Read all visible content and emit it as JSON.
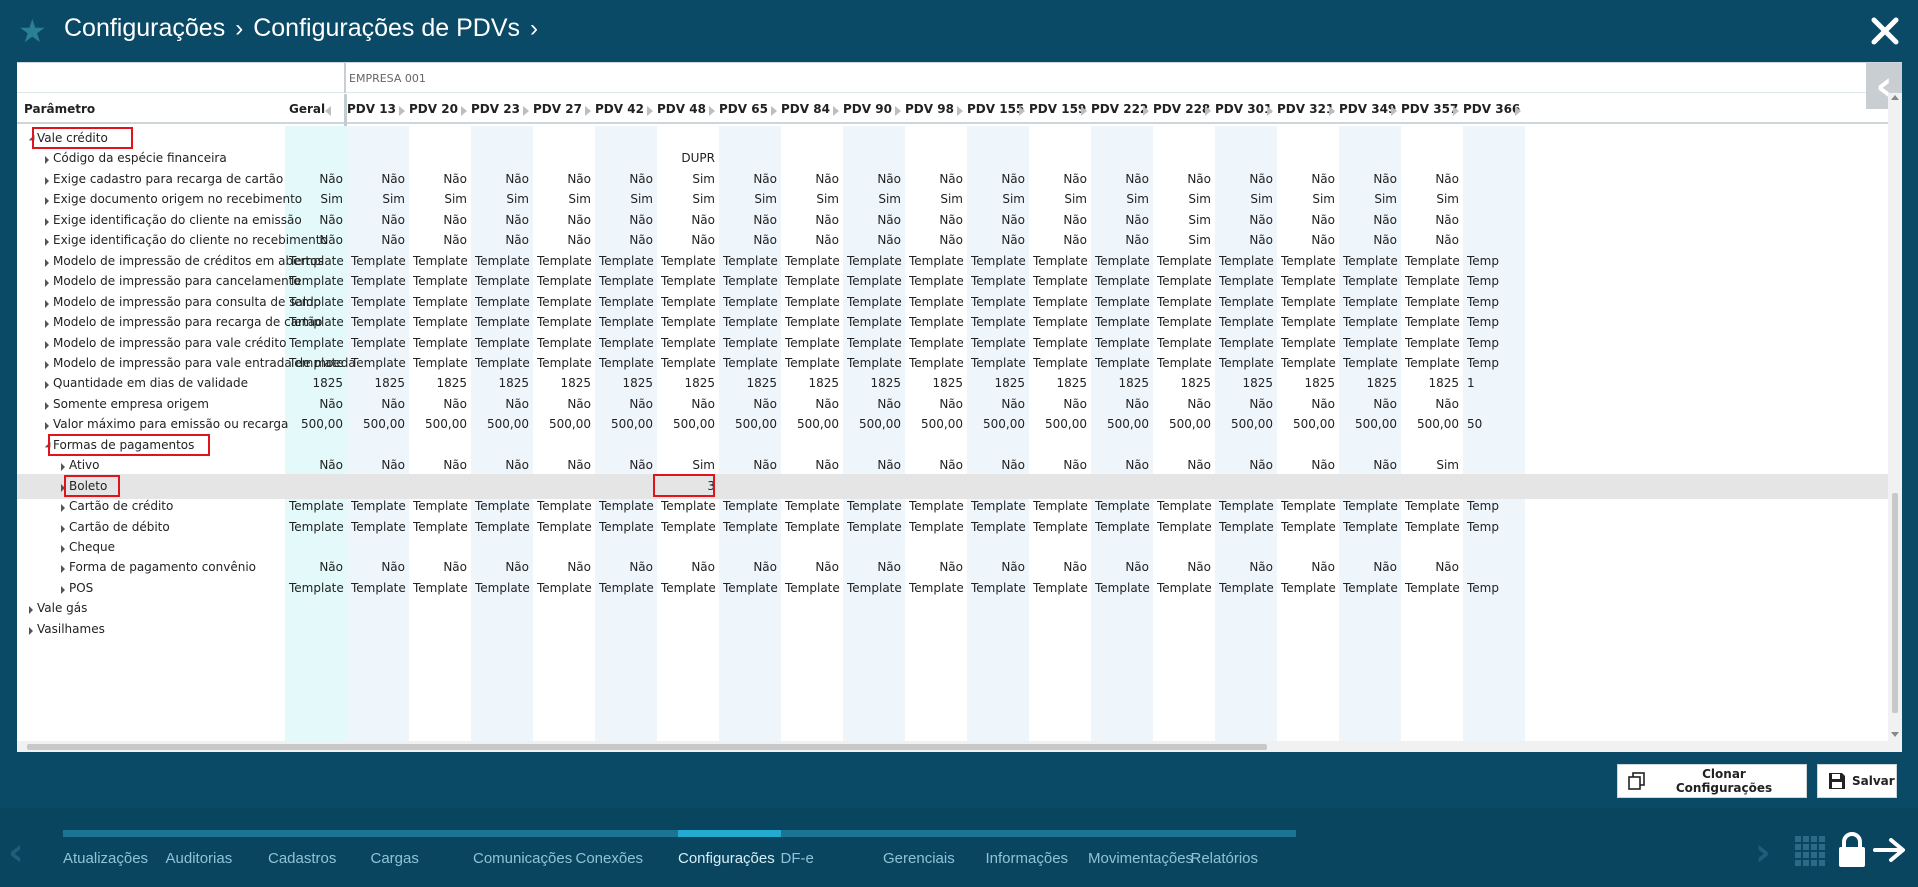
{
  "header": {
    "breadcrumb": [
      "Configurações",
      "Configurações de PDVs"
    ]
  },
  "grid": {
    "empresa": "EMPRESA 001",
    "param_header": "Parâmetro",
    "columns": [
      "Geral",
      "PDV 13",
      "PDV 20",
      "PDV 23",
      "PDV 27",
      "PDV 42",
      "PDV 48",
      "PDV 65",
      "PDV 84",
      "PDV 90",
      "PDV 98",
      "PDV 155",
      "PDV 159",
      "PDV 222",
      "PDV 228",
      "PDV 301",
      "PDV 321",
      "PDV 349",
      "PDV 357",
      "PDV 366"
    ],
    "rows": [
      {
        "level": 0,
        "expanded": true,
        "label": "Vale crédito",
        "highlight": true,
        "values": []
      },
      {
        "level": 1,
        "label": "Código da espécie financeira",
        "values": [
          "",
          "",
          "",
          "",
          "",
          "",
          "DUPR"
        ]
      },
      {
        "level": 1,
        "label": "Exige cadastro para recarga de cartão",
        "values": [
          "Não",
          "Não",
          "Não",
          "Não",
          "Não",
          "Não",
          "Sim",
          "Não",
          "Não",
          "Não",
          "Não",
          "Não",
          "Não",
          "Não",
          "Não",
          "Não",
          "Não",
          "Não",
          "Não"
        ]
      },
      {
        "level": 1,
        "label": "Exige documento origem no recebimento",
        "values": [
          "Sim",
          "Sim",
          "Sim",
          "Sim",
          "Sim",
          "Sim",
          "Sim",
          "Sim",
          "Sim",
          "Sim",
          "Sim",
          "Sim",
          "Sim",
          "Sim",
          "Sim",
          "Sim",
          "Sim",
          "Sim",
          "Sim"
        ]
      },
      {
        "level": 1,
        "label": "Exige identificação do cliente na emissão",
        "values": [
          "Não",
          "Não",
          "Não",
          "Não",
          "Não",
          "Não",
          "Não",
          "Não",
          "Não",
          "Não",
          "Não",
          "Não",
          "Não",
          "Não",
          "Sim",
          "Não",
          "Não",
          "Não",
          "Não"
        ]
      },
      {
        "level": 1,
        "label": "Exige identificação do cliente no recebimento",
        "values": [
          "Não",
          "Não",
          "Não",
          "Não",
          "Não",
          "Não",
          "Não",
          "Não",
          "Não",
          "Não",
          "Não",
          "Não",
          "Não",
          "Não",
          "Sim",
          "Não",
          "Não",
          "Não",
          "Não"
        ]
      },
      {
        "level": 1,
        "label": "Modelo de impressão de créditos em abertos",
        "values": [
          "Template",
          "Template",
          "Template",
          "Template",
          "Template",
          "Template",
          "Template",
          "Template",
          "Template",
          "Template",
          "Template",
          "Template",
          "Template",
          "Template",
          "Template",
          "Template",
          "Template",
          "Template",
          "Template",
          "Temp"
        ]
      },
      {
        "level": 1,
        "label": "Modelo de impressão para cancelamento",
        "values": [
          "Template",
          "Template",
          "Template",
          "Template",
          "Template",
          "Template",
          "Template",
          "Template",
          "Template",
          "Template",
          "Template",
          "Template",
          "Template",
          "Template",
          "Template",
          "Template",
          "Template",
          "Template",
          "Template",
          "Temp"
        ]
      },
      {
        "level": 1,
        "label": "Modelo de impressão para consulta de saldo",
        "values": [
          "Template",
          "Template",
          "Template",
          "Template",
          "Template",
          "Template",
          "Template",
          "Template",
          "Template",
          "Template",
          "Template",
          "Template",
          "Template",
          "Template",
          "Template",
          "Template",
          "Template",
          "Template",
          "Template",
          "Temp"
        ]
      },
      {
        "level": 1,
        "label": "Modelo de impressão para recarga de cartão",
        "values": [
          "Template",
          "Template",
          "Template",
          "Template",
          "Template",
          "Template",
          "Template",
          "Template",
          "Template",
          "Template",
          "Template",
          "Template",
          "Template",
          "Template",
          "Template",
          "Template",
          "Template",
          "Template",
          "Template",
          "Temp"
        ]
      },
      {
        "level": 1,
        "label": "Modelo de impressão para vale crédito",
        "values": [
          "Template",
          "Template",
          "Template",
          "Template",
          "Template",
          "Template",
          "Template",
          "Template",
          "Template",
          "Template",
          "Template",
          "Template",
          "Template",
          "Template",
          "Template",
          "Template",
          "Template",
          "Template",
          "Template",
          "Temp"
        ]
      },
      {
        "level": 1,
        "label": "Modelo de impressão para vale entrada de moeda",
        "values": [
          "Template",
          "Template",
          "Template",
          "Template",
          "Template",
          "Template",
          "Template",
          "Template",
          "Template",
          "Template",
          "Template",
          "Template",
          "Template",
          "Template",
          "Template",
          "Template",
          "Template",
          "Template",
          "Template",
          "Temp"
        ]
      },
      {
        "level": 1,
        "label": "Quantidade em dias de validade",
        "values": [
          "1825",
          "1825",
          "1825",
          "1825",
          "1825",
          "1825",
          "1825",
          "1825",
          "1825",
          "1825",
          "1825",
          "1825",
          "1825",
          "1825",
          "1825",
          "1825",
          "1825",
          "1825",
          "1825",
          "1"
        ]
      },
      {
        "level": 1,
        "label": "Somente empresa origem",
        "values": [
          "Não",
          "Não",
          "Não",
          "Não",
          "Não",
          "Não",
          "Não",
          "Não",
          "Não",
          "Não",
          "Não",
          "Não",
          "Não",
          "Não",
          "Não",
          "Não",
          "Não",
          "Não",
          "Não"
        ]
      },
      {
        "level": 1,
        "label": "Valor máximo para emissão ou recarga",
        "values": [
          "500,00",
          "500,00",
          "500,00",
          "500,00",
          "500,00",
          "500,00",
          "500,00",
          "500,00",
          "500,00",
          "500,00",
          "500,00",
          "500,00",
          "500,00",
          "500,00",
          "500,00",
          "500,00",
          "500,00",
          "500,00",
          "500,00",
          "50"
        ]
      },
      {
        "level": 1,
        "expanded": true,
        "label": "Formas de pagamentos",
        "highlight": true,
        "values": []
      },
      {
        "level": 2,
        "label": "Ativo",
        "values": [
          "Não",
          "Não",
          "Não",
          "Não",
          "Não",
          "Não",
          "Sim",
          "Não",
          "Não",
          "Não",
          "Não",
          "Não",
          "Não",
          "Não",
          "Não",
          "Não",
          "Não",
          "Não",
          "Sim"
        ]
      },
      {
        "level": 2,
        "label": "Boleto",
        "highlight": true,
        "selected": true,
        "values": [
          "",
          "",
          "",
          "",
          "",
          "",
          "3"
        ]
      },
      {
        "level": 2,
        "label": "Cartão de crédito",
        "values": [
          "Template",
          "Template",
          "Template",
          "Template",
          "Template",
          "Template",
          "Template",
          "Template",
          "Template",
          "Template",
          "Template",
          "Template",
          "Template",
          "Template",
          "Template",
          "Template",
          "Template",
          "Template",
          "Template",
          "Temp"
        ]
      },
      {
        "level": 2,
        "label": "Cartão de débito",
        "values": [
          "Template",
          "Template",
          "Template",
          "Template",
          "Template",
          "Template",
          "Template",
          "Template",
          "Template",
          "Template",
          "Template",
          "Template",
          "Template",
          "Template",
          "Template",
          "Template",
          "Template",
          "Template",
          "Template",
          "Temp"
        ]
      },
      {
        "level": 2,
        "label": "Cheque",
        "values": []
      },
      {
        "level": 2,
        "label": "Forma de pagamento convênio",
        "values": [
          "Não",
          "Não",
          "Não",
          "Não",
          "Não",
          "Não",
          "Não",
          "Não",
          "Não",
          "Não",
          "Não",
          "Não",
          "Não",
          "Não",
          "Não",
          "Não",
          "Não",
          "Não",
          "Não"
        ]
      },
      {
        "level": 2,
        "label": "POS",
        "values": [
          "Template",
          "Template",
          "Template",
          "Template",
          "Template",
          "Template",
          "Template",
          "Template",
          "Template",
          "Template",
          "Template",
          "Template",
          "Template",
          "Template",
          "Template",
          "Template",
          "Template",
          "Template",
          "Template",
          "Temp"
        ]
      },
      {
        "level": 0,
        "label": "Vale gás",
        "values": []
      },
      {
        "level": 0,
        "label": "Vasilhames",
        "values": []
      }
    ]
  },
  "actions": {
    "clone_label": "Clonar Configurações",
    "save_label": "Salvar"
  },
  "nav": {
    "items": [
      "Atualizações",
      "Auditorias",
      "Cadastros",
      "Cargas",
      "Comunicações",
      "Conexões",
      "Configurações",
      "DF-e",
      "Gerenciais",
      "Informações",
      "Movimentações",
      "Relatórios"
    ],
    "active": "Configurações"
  },
  "colors": {
    "background": "#0b4a66",
    "nav_bar": "#1c7394",
    "nav_bar_active": "#24a9d1",
    "highlight_border": "#e0141c",
    "stripe": "#eef5fb",
    "geral_column": "#e3f9fa"
  }
}
